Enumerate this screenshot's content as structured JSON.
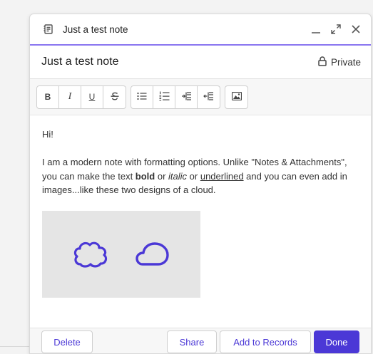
{
  "window": {
    "title": "Just a test note"
  },
  "header": {
    "note_title": "Just a test note",
    "privacy_label": "Private"
  },
  "toolbar": {
    "groups": [
      [
        "bold-icon",
        "italic-icon",
        "underline-icon",
        "strikethrough-icon"
      ],
      [
        "bulleted-list-icon",
        "numbered-list-icon",
        "decrease-indent-icon",
        "increase-indent-icon"
      ],
      [
        "image-icon"
      ]
    ],
    "bold": "B",
    "italic": "I",
    "underline": "U"
  },
  "content": {
    "greeting": "Hi!",
    "p2_part1": "I am a modern note with formatting options. Unlike \"Notes & Attachments\", you can make the text ",
    "p2_bold": "bold",
    "p2_or1": " or ",
    "p2_italic": "italic",
    "p2_or2": " or ",
    "p2_underlined": "underlined",
    "p2_part2": " and you can even add in images...like these two designs of a cloud."
  },
  "footer": {
    "delete_label": "Delete",
    "share_label": "Share",
    "add_to_records_label": "Add to Records",
    "done_label": "Done"
  },
  "colors": {
    "accent": "#4b38d6",
    "title_underline": "#8a76f0",
    "image_bg": "#e5e5e5"
  }
}
